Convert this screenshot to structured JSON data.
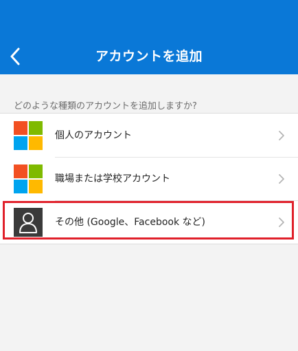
{
  "header": {
    "title": "アカウントを追加",
    "back_icon": "chevron-left-icon"
  },
  "prompt": "どのような種類のアカウントを追加しますか?",
  "accounts": [
    {
      "label": "個人のアカウント",
      "icon": "microsoft-logo-icon"
    },
    {
      "label": "職場または学校アカウント",
      "icon": "microsoft-logo-icon"
    },
    {
      "label": "その他 (Google、Facebook など)",
      "icon": "person-icon"
    }
  ],
  "colors": {
    "header_bg": "#0a78d7",
    "ms_red": "#f25022",
    "ms_green": "#7fba00",
    "ms_blue": "#00a4ef",
    "ms_yellow": "#ffb900",
    "highlight": "#e0202a"
  }
}
